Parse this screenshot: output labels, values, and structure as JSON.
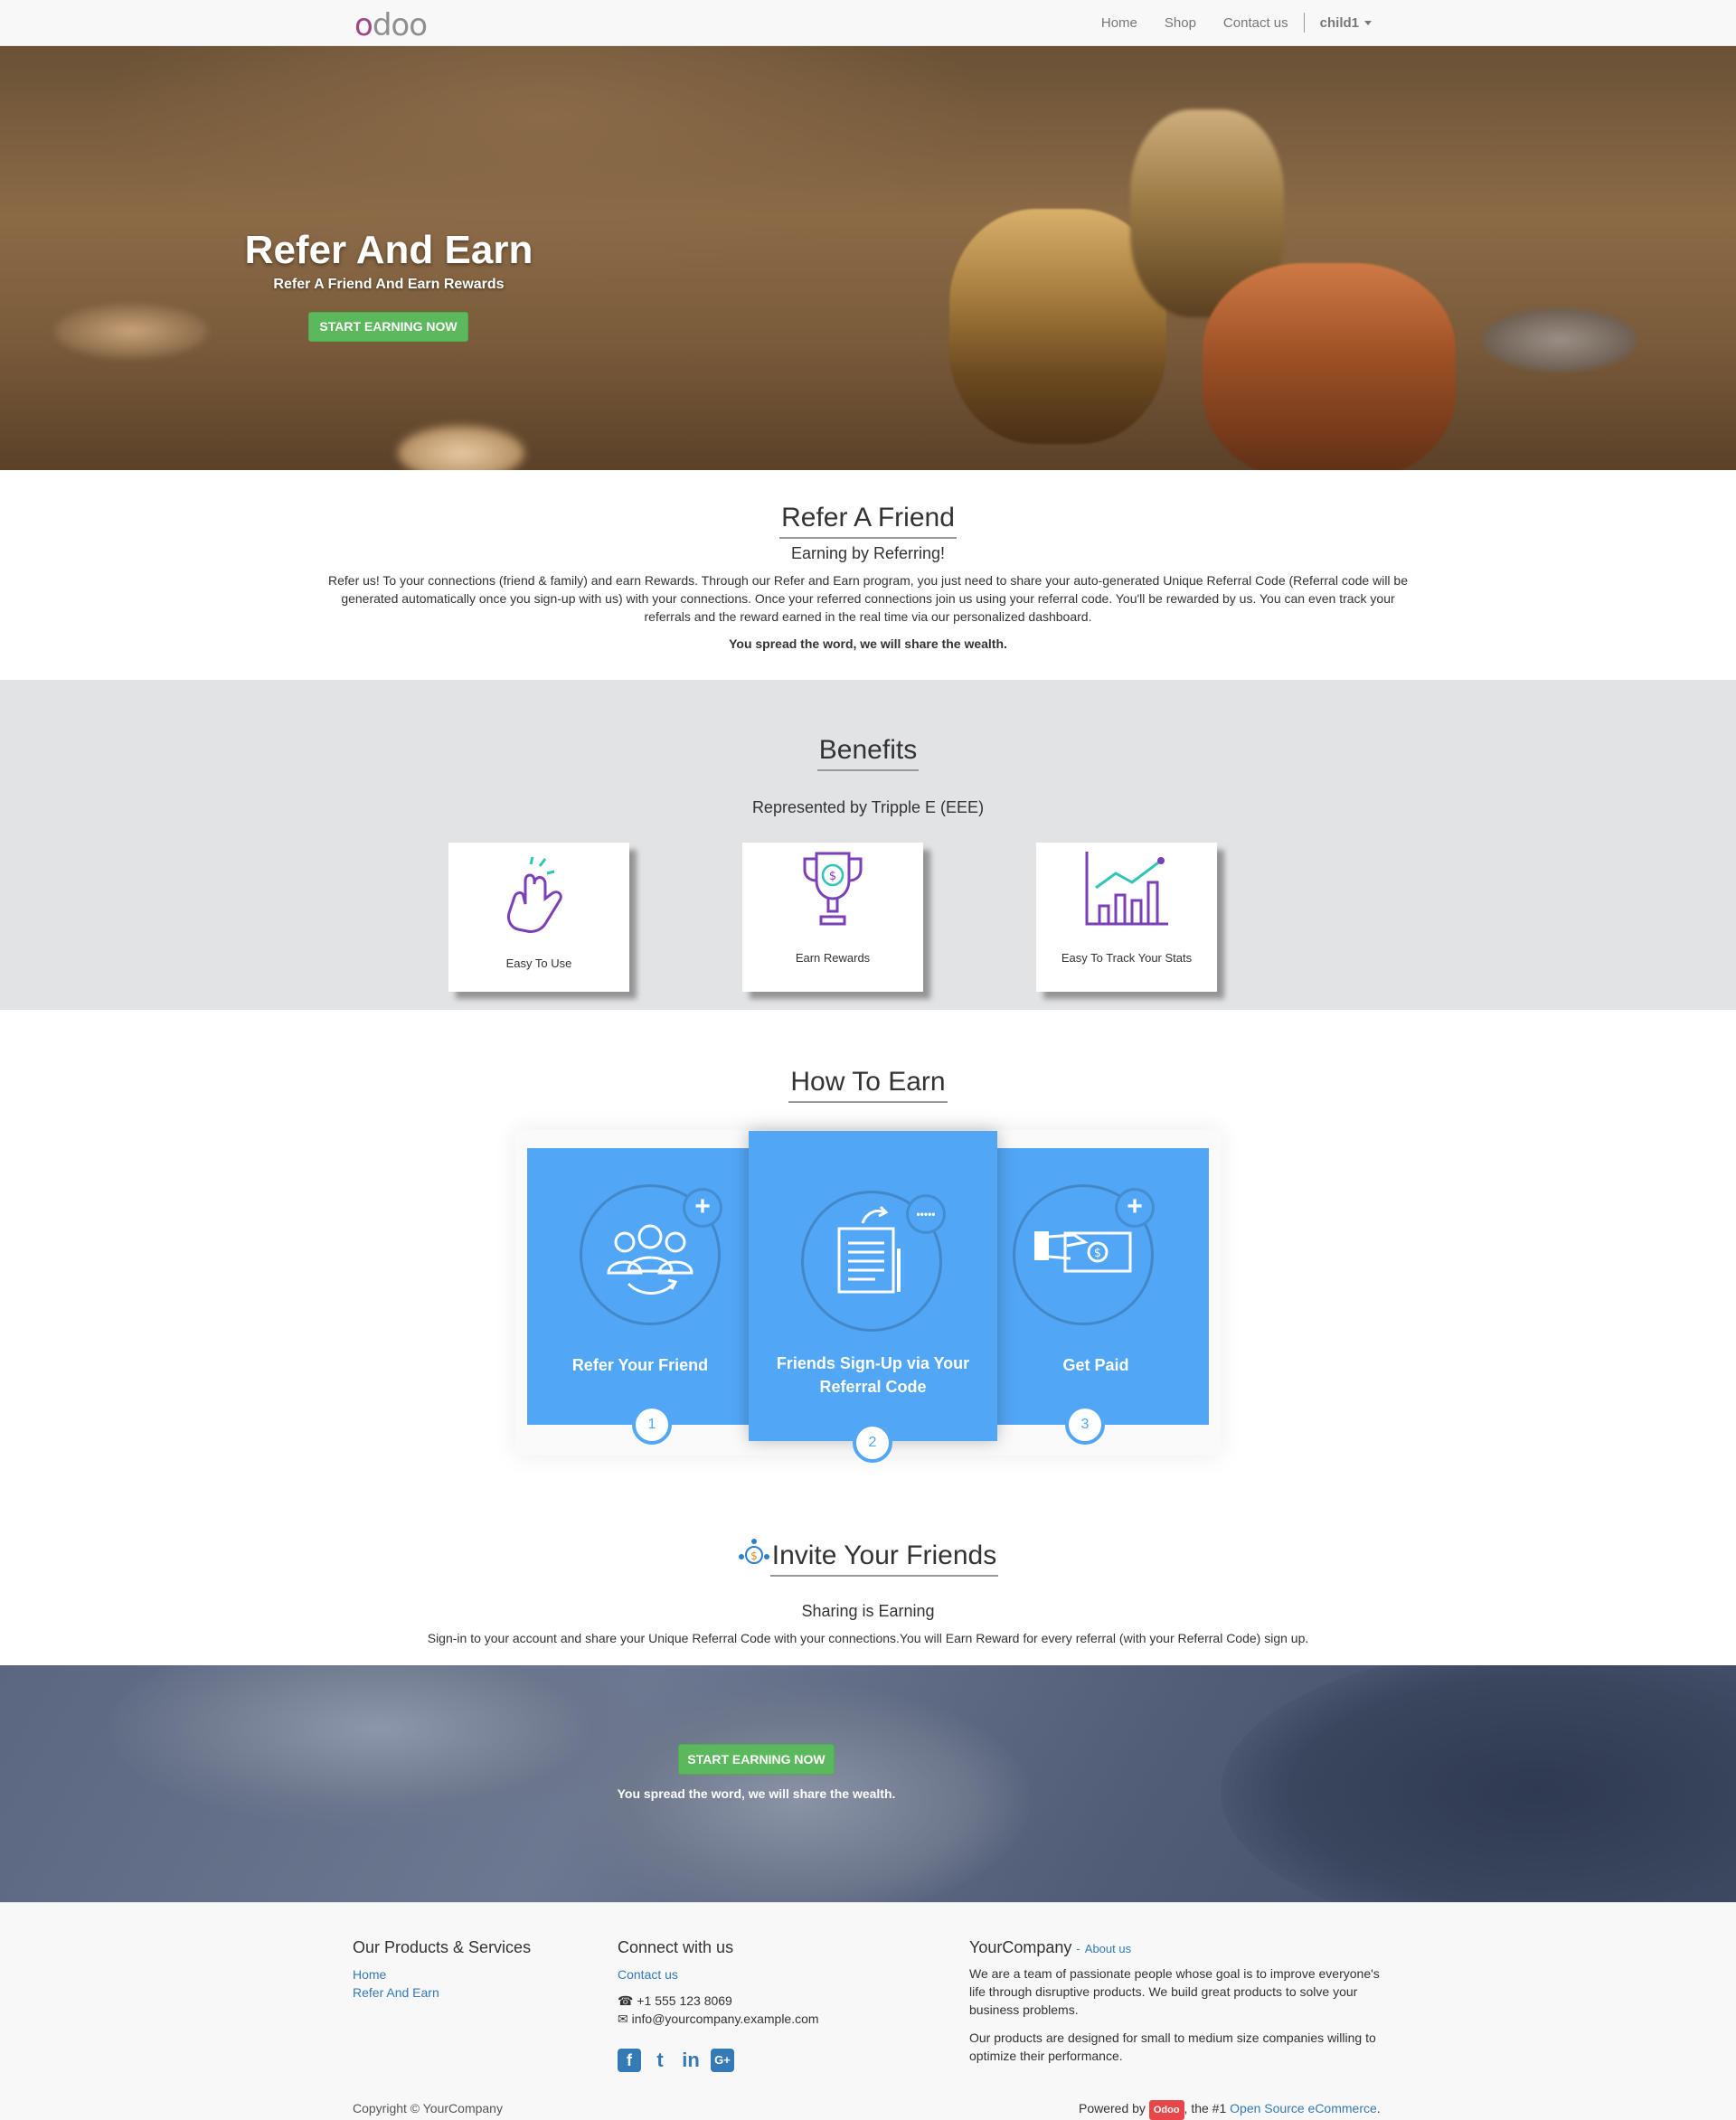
{
  "nav": {
    "logo": "odoo",
    "links": [
      "Home",
      "Shop",
      "Contact us"
    ],
    "user": "child1"
  },
  "hero": {
    "title": "Refer And Earn",
    "subtitle": "Refer A Friend And Earn Rewards",
    "button": "START EARNING NOW"
  },
  "refer": {
    "title": "Refer A Friend",
    "subtitle": "Earning by Referring!",
    "body": "Refer us! To your connections (friend & family) and earn Rewards. Through our Refer and Earn program, you just need to share your auto-generated Unique Referral Code (Referral code will be generated automatically once you sign-up with us) with your connections. Once your referred connections join us using your referral code. You'll be rewarded by us. You can even track your referrals and the reward earned in the real time via our personalized dashboard.",
    "tagline": "You spread the word, we will share the wealth."
  },
  "benefits": {
    "title": "Benefits",
    "subtitle": "Represented by Tripple E (EEE)",
    "items": [
      {
        "label": "Easy To Use",
        "icon": "hand-tap-icon"
      },
      {
        "label": "Earn Rewards",
        "icon": "trophy-icon"
      },
      {
        "label": "Easy To Track Your Stats",
        "icon": "chart-icon"
      }
    ],
    "icon_color": "#7b3fb8"
  },
  "how": {
    "title": "How To Earn",
    "steps": [
      {
        "label": "Refer Your Friend",
        "num": "1"
      },
      {
        "label": "Friends Sign-Up via Your Referral Code",
        "num": "2"
      },
      {
        "label": "Get Paid",
        "num": "3"
      }
    ],
    "card_color": "#51a6f5"
  },
  "invite": {
    "title": "Invite Your Friends",
    "subtitle": "Sharing is Earning",
    "body": "Sign-in to your account and share your Unique Referral Code with your connections.You will Earn Reward for every referral (with your Referral Code) sign up.",
    "button": "START EARNING NOW",
    "tagline": "You spread the word, we will share the wealth."
  },
  "footer": {
    "products_title": "Our Products & Services",
    "products_links": [
      "Home",
      "Refer And Earn"
    ],
    "connect_title": "Connect with us",
    "contact_link": "Contact us",
    "phone": "+1 555 123 8069",
    "email": "info@yourcompany.example.com",
    "company": "YourCompany",
    "about_link": "About us",
    "about_sep": "-",
    "about_p1": "We are a team of passionate people whose goal is to improve everyone's life through disruptive products. We build great products to solve your business problems.",
    "about_p2": "Our products are designed for small to medium size companies willing to optimize their performance.",
    "copyright": "Copyright © YourCompany",
    "powered_by": "Powered by",
    "badge": "Odoo",
    "powered_mid": ", the #1",
    "powered_link": "Open Source eCommerce",
    "powered_end": ".",
    "social": [
      "f",
      "t",
      "in",
      "G+"
    ]
  }
}
